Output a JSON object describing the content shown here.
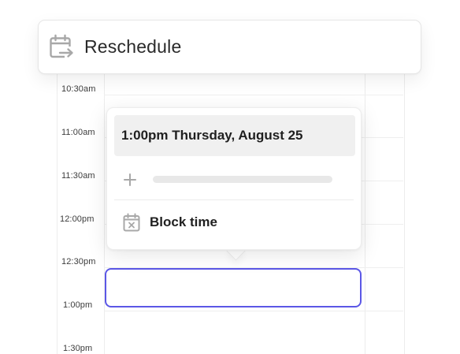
{
  "reschedule": {
    "label": "Reschedule",
    "icon": "calendar-arrow-icon"
  },
  "calendar": {
    "times": [
      "10:30am",
      "11:00am",
      "11:30am",
      "12:00pm",
      "12:30pm",
      "1:00pm",
      "1:30pm"
    ]
  },
  "popover": {
    "datetime": "1:00pm Thursday, August 25",
    "add_icon": "plus-icon",
    "block_time_label": "Block time",
    "block_time_icon": "calendar-x-icon"
  },
  "colors": {
    "accent": "#5b57e6",
    "header_bg": "#f0f0f0",
    "text": "#1f1f1f",
    "icon_gray": "#a8a8a8"
  }
}
